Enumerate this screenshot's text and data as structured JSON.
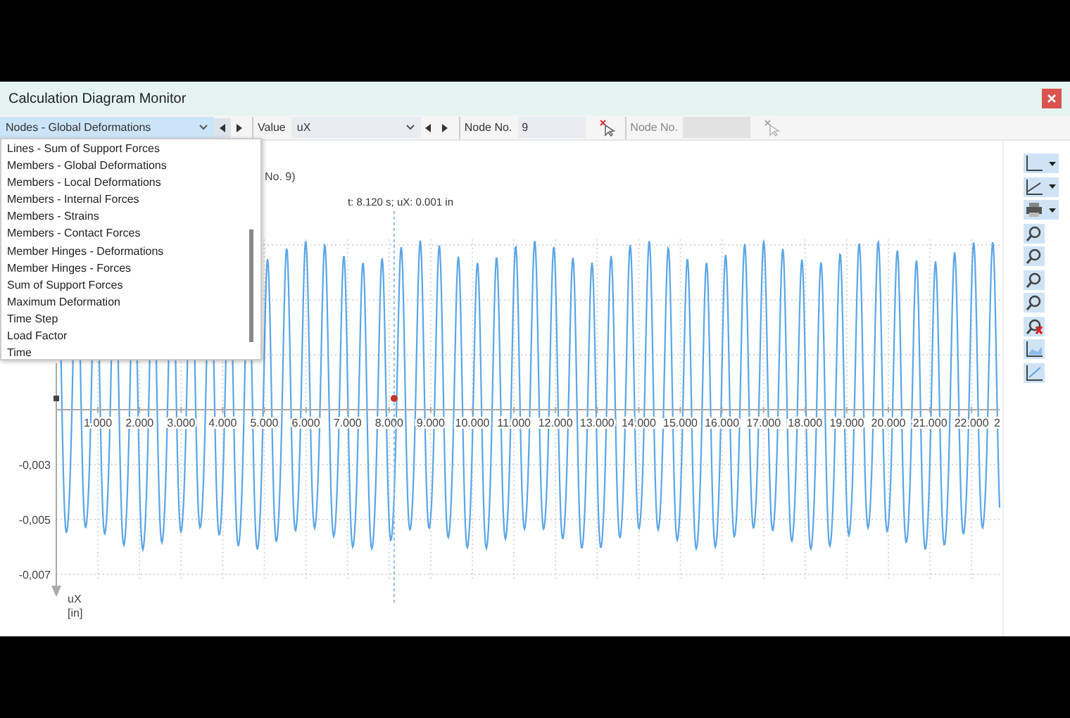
{
  "window": {
    "title": "Calculation Diagram Monitor"
  },
  "toolbar": {
    "category": {
      "value": "Nodes - Global Deformations",
      "expanded": true
    },
    "value_label": "Value",
    "value_select": "uX",
    "node_label": "Node No.",
    "node_value": "9",
    "node2_label": "Node No.",
    "node2_disabled": true
  },
  "category_options": [
    "Lines - Sum of Support Forces",
    "Members - Global Deformations",
    "Members - Local Deformations",
    "Members - Internal Forces",
    "Members - Strains",
    "Members - Contact Forces",
    "Member Hinges - Deformations",
    "Member Hinges - Forces",
    "Sum of Support Forces",
    "Maximum Deformation",
    "Time Step",
    "Load Factor",
    "Time"
  ],
  "chart": {
    "title_fragment": "No. 9)",
    "tooltip": "t: 8.120 s; uX: 0.001 in",
    "x_tick_labels": [
      "1.000",
      "2.000",
      "3.000",
      "4.000",
      "5.000",
      "6.000",
      "7.000",
      "8.000",
      "9.000",
      "10.000",
      "11.000",
      "12.000",
      "13.000",
      "14.000",
      "15.000",
      "16.000",
      "17.000",
      "18.000",
      "19.000",
      "20.000",
      "21.000",
      "22.000",
      "2"
    ],
    "y_tick_labels": [
      "-0,003",
      "-0,005",
      "-0,007"
    ],
    "y_axis_label": "uX",
    "y_axis_unit": "[in]"
  }
}
